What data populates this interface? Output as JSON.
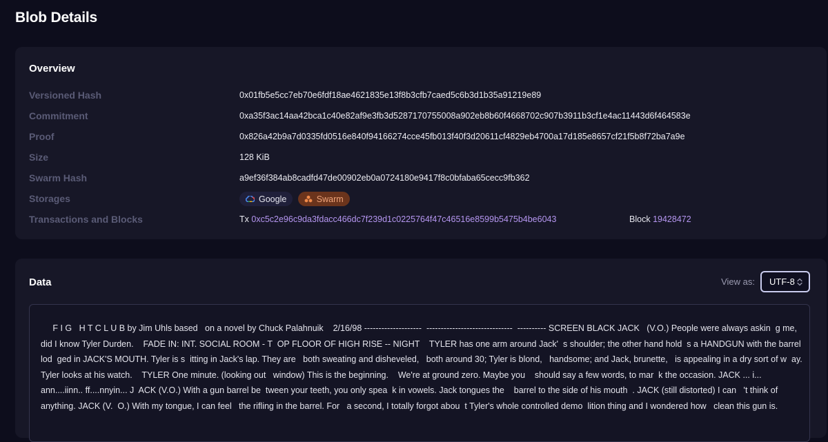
{
  "page": {
    "title": "Blob Details"
  },
  "overview": {
    "title": "Overview",
    "versioned_hash_label": "Versioned Hash",
    "versioned_hash": "0x01fb5e5cc7eb70e6fdf18ae4621835e13f8b3cfb7caed5c6b3d1b35a91219e89",
    "commitment_label": "Commitment",
    "commitment": "0xa35f3ac14aa42bca1c40e82af9e3fb3d5287170755008a902eb8b60f4668702c907b3911b3cf1e4ac11443d6f464583e",
    "proof_label": "Proof",
    "proof": "0x826a42b9a7d0335fd0516e840f94166274cce45fb013f40f3d20611cf4829eb4700a17d185e8657cf21f5b8f72ba7a9e",
    "size_label": "Size",
    "size": "128 KiB",
    "swarm_hash_label": "Swarm Hash",
    "swarm_hash": "a9ef36f384ab8cadfd47de00902eb0a0724180e9417f8c0bfaba65cecc9fb362",
    "storages_label": "Storages",
    "storages": [
      {
        "name": "Google",
        "icon": "google-cloud-icon",
        "color": "#20203a"
      },
      {
        "name": "Swarm",
        "icon": "swarm-icon",
        "color": "#6b341c"
      }
    ],
    "tx_blocks_label": "Transactions and Blocks",
    "tx_prefix": "Tx",
    "tx_hash": "0xc5c2e96c9da3fdacc466dc7f239d1c0225764f47c46516e8599b5475b4be6043",
    "block_prefix": "Block",
    "block_number": "19428472"
  },
  "data_section": {
    "title": "Data",
    "view_as_label": "View as:",
    "encoding": "UTF-8",
    "content": "     F I G   H T C L U B by Jim Uhls based   on a novel by Chuck Palahnuik    2/16/98 --------------------  ------------------------------  ---------- SCREEN BLACK JACK   (V.O.) People were always askin  g me, did I know Tyler Durden.    FADE IN: INT. SOCIAL ROOM - T  OP FLOOR OF HIGH RISE -- NIGHT    TYLER has one arm around Jack'  s shoulder; the other hand hold  s a HANDGUN with the barrel lod  ged in JACK'S MOUTH. Tyler is s  itting in Jack's lap. They are   both sweating and disheveled,   both around 30; Tyler is blond,   handsome; and Jack, brunette,   is appealing in a dry sort of w  ay. Tyler looks at his watch.    TYLER One minute. (looking out   window) This is the beginning.    We're at ground zero. Maybe you    should say a few words, to mar  k the occasion. JACK ... i...   ann....iinn.. ff....nnyin... J  ACK (V.O.) With a gun barrel be  tween your teeth, you only spea  k in vowels. Jack tongues the    barrel to the side of his mouth  . JACK (still distorted) I can   't think of anything. JACK (V.  O.) With my tongue, I can feel   the rifling in the barrel. For   a second, I totally forgot abou  t Tyler's whole controlled demo  lition thing and I wondered how   clean this gun is."
  },
  "colors": {
    "background": "#0d0d1c",
    "card": "#171727",
    "label": "#5a5b76",
    "link": "#b596f0",
    "swarm_chip": "#6b341c"
  }
}
